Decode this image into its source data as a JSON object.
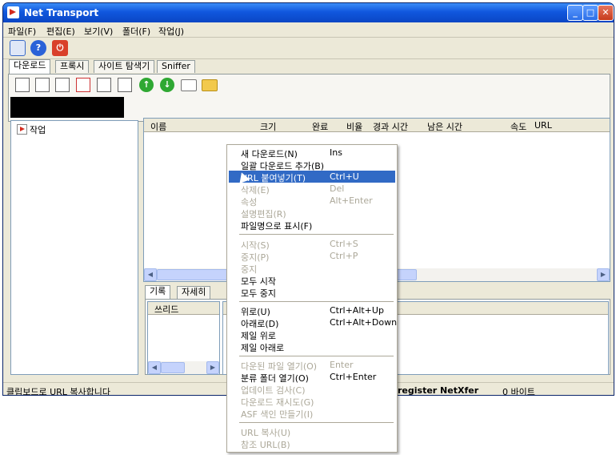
{
  "window": {
    "title": "Net Transport",
    "min": "_",
    "max": "□",
    "close": "✕"
  },
  "menubar": [
    "파일(F)",
    "편집(E)",
    "보기(V)",
    "폴더(F)",
    "작업(J)"
  ],
  "toolbar1": {
    "help_symbol": "?",
    "power_symbol": "⏻"
  },
  "tabs": [
    "다운로드",
    "프록시",
    "사이트 탐색기",
    "Sniffer"
  ],
  "tree": {
    "root_label": "작업"
  },
  "list_columns": [
    "이름",
    "크기",
    "완료",
    "비율",
    "경과 시간",
    "남은 시간",
    "속도",
    "URL"
  ],
  "bottom_tabs": [
    "기록",
    "자세히"
  ],
  "thread_column": "쓰리드",
  "statusbar": {
    "message": "클립보드로 URL 복사합니다",
    "register": "register NetXfer",
    "bytes": "0 바이트"
  },
  "context_menu": [
    {
      "label": "새 다운로드(N)",
      "shortcut": "Ins",
      "disabled": false
    },
    {
      "label": "일괄 다운로드 추가(B)",
      "shortcut": "",
      "disabled": false
    },
    {
      "label": "URL 붙여넣기(T)",
      "shortcut": "Ctrl+U",
      "disabled": false,
      "highlighted": true
    },
    {
      "label": "삭제(E)",
      "shortcut": "Del",
      "disabled": true
    },
    {
      "label": "속성",
      "shortcut": "Alt+Enter",
      "disabled": true
    },
    {
      "label": "설명편집(R)",
      "shortcut": "",
      "disabled": true
    },
    {
      "label": "파일명으로 표시(F)",
      "shortcut": "",
      "disabled": false
    },
    {
      "label": "시작(S)",
      "shortcut": "Ctrl+S",
      "disabled": true
    },
    {
      "label": "중지(P)",
      "shortcut": "Ctrl+P",
      "disabled": true
    },
    {
      "label": "중지",
      "shortcut": "",
      "disabled": true
    },
    {
      "label": "모두 시작",
      "shortcut": "",
      "disabled": false
    },
    {
      "label": "모두 중지",
      "shortcut": "",
      "disabled": false
    },
    {
      "label": "위로(U)",
      "shortcut": "Ctrl+Alt+Up",
      "disabled": false
    },
    {
      "label": "아래로(D)",
      "shortcut": "Ctrl+Alt+Down",
      "disabled": false
    },
    {
      "label": "제일 위로",
      "shortcut": "",
      "disabled": false
    },
    {
      "label": "제일 아래로",
      "shortcut": "",
      "disabled": false
    },
    {
      "label": "다운된 파일 열기(O)",
      "shortcut": "Enter",
      "disabled": true
    },
    {
      "label": "분류 폴더 열기(O)",
      "shortcut": "Ctrl+Enter",
      "disabled": false
    },
    {
      "label": "업데이트 검사(C)",
      "shortcut": "",
      "disabled": true
    },
    {
      "label": "다운로드 재시도(G)",
      "shortcut": "",
      "disabled": true
    },
    {
      "label": "ASF 색인 만들기(I)",
      "shortcut": "",
      "disabled": true
    },
    {
      "label": "URL 복사(U)",
      "shortcut": "",
      "disabled": true
    },
    {
      "label": "참조 URL(B)",
      "shortcut": "",
      "disabled": true
    }
  ],
  "colors": {
    "title_blue": "#0a46c4",
    "highlight": "#316ac5",
    "disabled_text": "#aca899"
  }
}
